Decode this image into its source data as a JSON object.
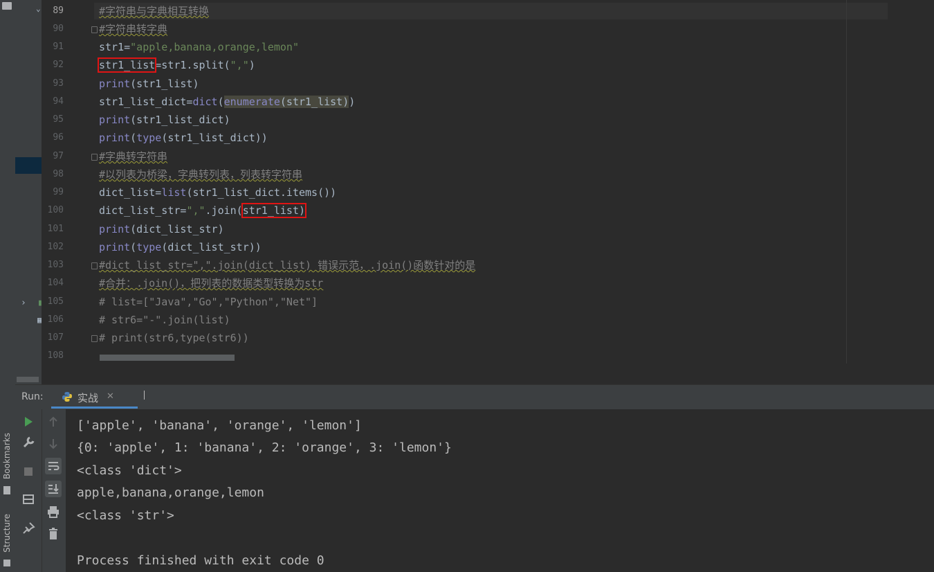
{
  "left_strip": {
    "bookmarks_label": "Bookmarks",
    "structure_label": "Structure"
  },
  "editor": {
    "line_numbers": [
      "89",
      "90",
      "91",
      "92",
      "93",
      "94",
      "95",
      "96",
      "97",
      "98",
      "99",
      "100",
      "101",
      "102",
      "103",
      "104",
      "105",
      "106",
      "107",
      "108"
    ],
    "lines": {
      "l89": "#字符串与字典相互转换",
      "l90": "#字符串转字典",
      "l91_a": "str1=",
      "l91_b": "\"apple,banana,orange,lemon\"",
      "l92_a": "str1_list",
      "l92_b": "=str1.split(",
      "l92_c": "\",\"",
      "l92_d": ")",
      "l93_a": "print",
      "l93_b": "(str1_list)",
      "l94_a": "str1_list_dict=",
      "l94_b": "dict",
      "l94_c": "(",
      "l94_d": "enumerate",
      "l94_e": "(str1_list)",
      "l94_f": ")",
      "l95_a": "print",
      "l95_b": "(str1_list_dict)",
      "l96_a": "print",
      "l96_b": "(",
      "l96_c": "type",
      "l96_d": "(str1_list_dict))",
      "l97": "#字典转字符串",
      "l98": "#以列表为桥梁，字典转列表，列表转字符串",
      "l99_a": "dict_list=",
      "l99_b": "list",
      "l99_c": "(str1_list_dict.items())",
      "l100_a": "dict_list_str=",
      "l100_b": "\",\"",
      "l100_c": ".join(",
      "l100_d": "str1_list)",
      "l101_a": "print",
      "l101_b": "(dict_list_str)",
      "l102_a": "print",
      "l102_b": "(",
      "l102_c": "type",
      "l102_d": "(dict_list_str))",
      "l103": "#dict_list_str=\",\".join(dict_list) 错误示范，.join()函数针对的是",
      "l104": "#合并：.join()，把列表的数据类型转换为str",
      "l105": "# list=[\"Java\",\"Go\",\"Python\",\"Net\"]",
      "l106": "# str6=\"-\".join(list)",
      "l107": "# print(str6,type(str6))"
    }
  },
  "run_panel": {
    "label": "Run:",
    "tab_name": "实战",
    "tab_close": "✕",
    "output_lines": [
      "['apple', 'banana', 'orange', 'lemon']",
      "{0: 'apple', 1: 'banana', 2: 'orange', 3: 'lemon'}",
      "<class 'dict'>",
      "apple,banana,orange,lemon",
      "<class 'str'>",
      "",
      "Process finished with exit code 0"
    ]
  },
  "colors": {
    "editor_bg": "#2b2b2b",
    "panel_bg": "#3c3f41",
    "comment": "#808080",
    "string": "#6a8759",
    "builtin": "#8888c6",
    "highlight_box": "#e01414",
    "tab_underline": "#4a88c7"
  }
}
